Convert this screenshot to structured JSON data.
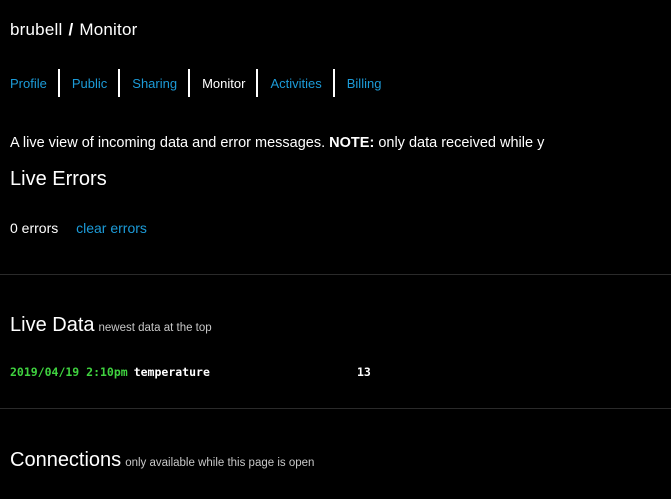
{
  "header": {
    "user": "brubell",
    "separator": "/",
    "page": "Monitor"
  },
  "tabs": [
    {
      "label": "Profile",
      "active": false
    },
    {
      "label": "Public",
      "active": false
    },
    {
      "label": "Sharing",
      "active": false
    },
    {
      "label": "Monitor",
      "active": true
    },
    {
      "label": "Activities",
      "active": false
    },
    {
      "label": "Billing",
      "active": false
    }
  ],
  "intro": {
    "text": "A live view of incoming data and error messages.",
    "note_label": "NOTE:",
    "note_text": "only data received while y"
  },
  "live_errors": {
    "title": "Live Errors",
    "count_text": "0 errors",
    "clear_link": "clear errors"
  },
  "live_data": {
    "title": "Live Data",
    "subtitle": "newest data at the top",
    "rows": [
      {
        "timestamp": "2019/04/19 2:10pm",
        "key": "temperature",
        "value": "13"
      }
    ]
  },
  "connections": {
    "title": "Connections",
    "subtitle": "only available while this page is open"
  },
  "colors": {
    "background": "#000000",
    "link": "#1c9bd8",
    "timestamp": "#3fd23f"
  }
}
